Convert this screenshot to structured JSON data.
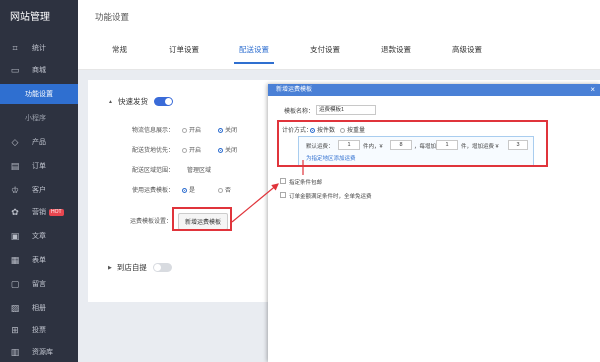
{
  "sidebar": {
    "title": "网站管理",
    "items": [
      {
        "label": "统计",
        "icon": "chart-icon"
      },
      {
        "label": "商城",
        "icon": "store-icon"
      },
      {
        "label": "功能设置",
        "icon": ""
      },
      {
        "label": "小程序",
        "icon": ""
      },
      {
        "label": "产品",
        "icon": "product-icon"
      },
      {
        "label": "订单",
        "icon": "order-icon"
      },
      {
        "label": "客户",
        "icon": "customer-icon"
      },
      {
        "label": "营销",
        "icon": "marketing-icon",
        "badge": "HOT"
      },
      {
        "label": "文章",
        "icon": "article-icon"
      },
      {
        "label": "表单",
        "icon": "form-icon"
      },
      {
        "label": "留言",
        "icon": "message-icon"
      },
      {
        "label": "相册",
        "icon": "album-icon"
      },
      {
        "label": "投票",
        "icon": "vote-icon"
      },
      {
        "label": "资源库",
        "icon": "resource-icon"
      }
    ]
  },
  "page": {
    "title": "功能设置",
    "tabs": [
      "常规",
      "订单设置",
      "配送设置",
      "支付设置",
      "退款设置",
      "高级设置"
    ],
    "active_tab": 2
  },
  "delivery": {
    "express_title": "快速发货",
    "rows": [
      {
        "label": "物流信息展示：",
        "opt1": "开启",
        "opt2": "关闭",
        "selected": 2
      },
      {
        "label": "配送货地优先：",
        "opt1": "开启",
        "opt2": "关闭",
        "selected": 2
      },
      {
        "label": "配送区域范围：",
        "value": "管理区域"
      },
      {
        "label": "使用运费模板：",
        "opt1": "是",
        "opt2": "否",
        "selected": 1
      }
    ],
    "template_label": "运费模板设置：",
    "add_template_btn": "新增运费模板",
    "pickup_title": "到店自提"
  },
  "dialog": {
    "title": "新增运费模板",
    "close": "×",
    "name_label": "模板名称：",
    "name_value": "运费模板1",
    "method_label": "计价方式：",
    "method_opt1": "按件数",
    "method_opt2": "按重量",
    "default_label": "默认运费：",
    "first_qty": "1",
    "unit_within": "件内，¥",
    "first_fee": "8",
    "each_add_label": "，每增加",
    "add_qty": "1",
    "add_unit": "件，增加运费 ¥",
    "add_fee": "3",
    "region_link": "为指定地区添加运费",
    "free_label": "指定条件包邮",
    "free_cond": "订单金额满足条件时，全单免运费"
  },
  "colors": {
    "accent": "#2f6fd0",
    "highlight": "#e0343b",
    "sidebar": "#2d3240",
    "dialog_head": "#4a80d6"
  }
}
